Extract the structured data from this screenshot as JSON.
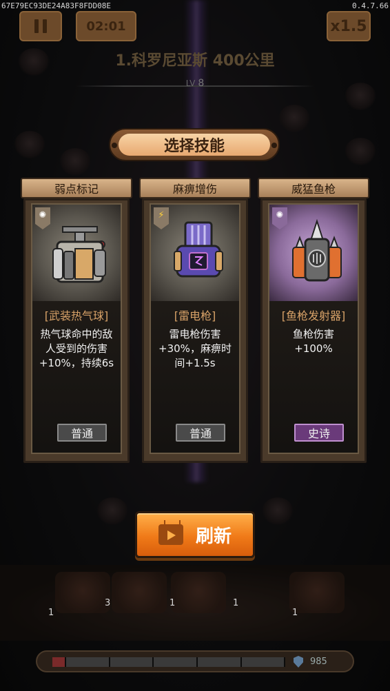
{
  "device_id": "67E79EC93DE24A83F8FDD08E",
  "version": "0.4.7.66",
  "hud": {
    "timer": "02:01",
    "speed": "x1.5",
    "stage_title": "1.科罗尼亚斯 400公里",
    "level_label": "LV",
    "level_value": "8"
  },
  "dialog": {
    "title": "选择技能",
    "refresh_label": "刷新"
  },
  "cards": [
    {
      "header": "弱点标记",
      "weapon": "[武装热气球]",
      "description": "热气球命中的敌人受到的伤害+10%，持续6s",
      "rarity": "普通",
      "badge_icon": "gear-icon"
    },
    {
      "header": "麻痹增伤",
      "weapon": "[雷电枪]",
      "description": "雷电枪伤害+30%，麻痹时间+1.5s",
      "rarity": "普通",
      "badge_icon": "lightning-icon"
    },
    {
      "header": "威猛鱼枪",
      "weapon": "[鱼枪发射器]",
      "description": "鱼枪伤害+100%",
      "rarity": "史诗",
      "badge_icon": "gear-icon"
    }
  ],
  "deck": {
    "slot_counts": [
      "1",
      "3",
      "1",
      "1",
      "1"
    ]
  },
  "base": {
    "hp": "985"
  },
  "colors": {
    "accent_orange": "#f07a18",
    "common_rarity": "#4a4a4a",
    "epic_rarity": "#6a3a7a"
  }
}
